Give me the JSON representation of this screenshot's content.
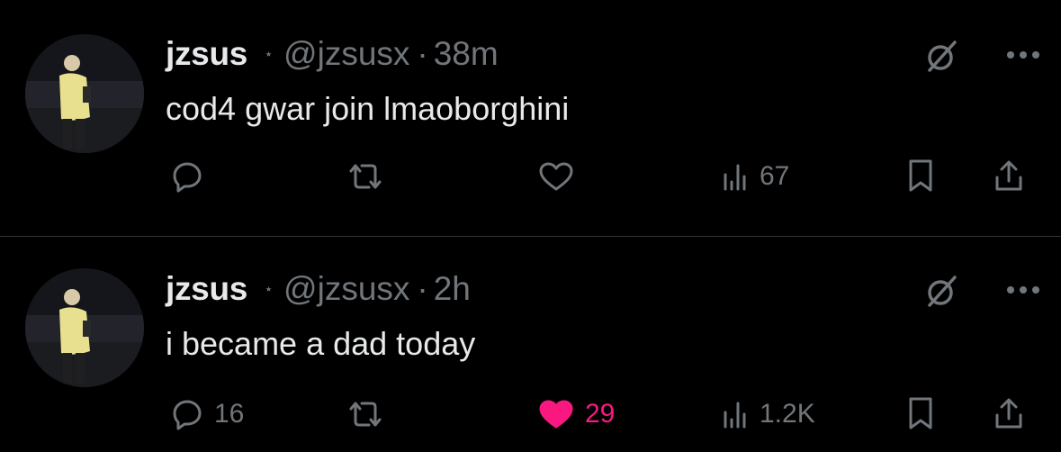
{
  "tweets": [
    {
      "author": {
        "name": "jzsus",
        "handle": "@jzsusx"
      },
      "time": "38m",
      "separator": "·",
      "text": "cod4 gwar join lmaoborghini",
      "metrics": {
        "replies": "",
        "retweets": "",
        "likes": "",
        "views": "67"
      },
      "liked": false
    },
    {
      "author": {
        "name": "jzsus",
        "handle": "@jzsusx"
      },
      "time": "2h",
      "separator": "·",
      "text": "i became a dad today",
      "metrics": {
        "replies": "16",
        "retweets": "",
        "likes": "29",
        "views": "1.2K"
      },
      "liked": true
    }
  ],
  "colors": {
    "background": "#000000",
    "text": "#e7e9ea",
    "muted": "#71767b",
    "like": "#f91880",
    "divider": "#2f3336"
  },
  "icons": [
    "crescent-star-icon",
    "grok-icon",
    "more-icon",
    "reply-icon",
    "retweet-icon",
    "like-icon",
    "views-icon",
    "bookmark-icon",
    "share-icon"
  ]
}
